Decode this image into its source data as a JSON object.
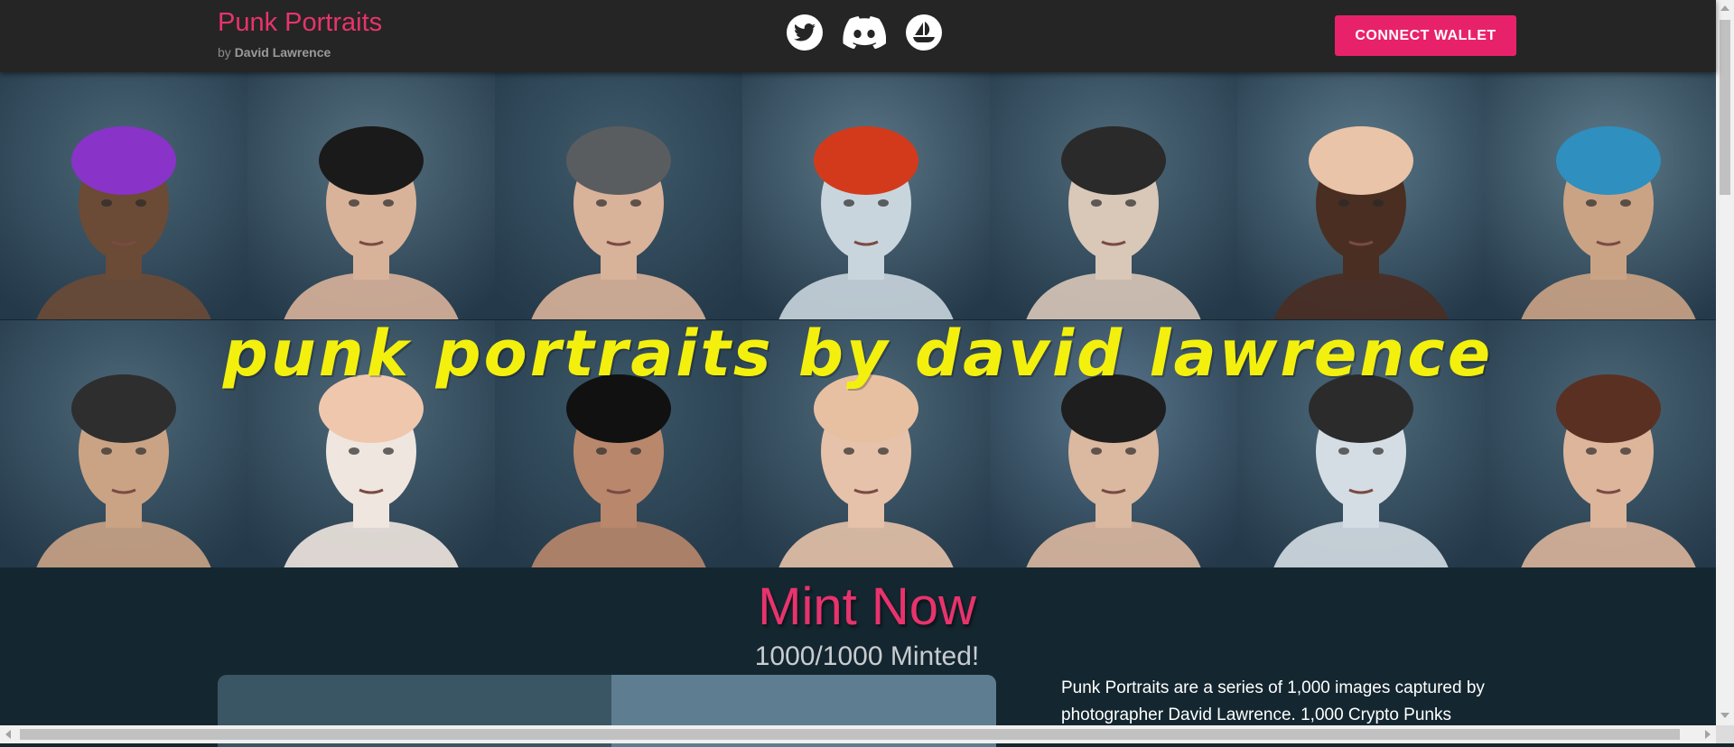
{
  "header": {
    "title": "Punk Portraits",
    "by_prefix": "by",
    "author": "David Lawrence",
    "connect_label": "CONNECT WALLET",
    "socials": [
      "twitter-icon",
      "discord-icon",
      "opensea-icon"
    ]
  },
  "hero": {
    "title": "punk portraits by david lawrence",
    "portraits": [
      {
        "name": "portrait-purple-wig-3d-glasses",
        "skin": "#6b4a36",
        "hair": "#8a33c8",
        "bg": "#4a6676"
      },
      {
        "name": "portrait-curly-hair-3d-glasses",
        "skin": "#d8b39a",
        "hair": "#1a1a1a",
        "bg": "#55707f"
      },
      {
        "name": "portrait-grey-hoodie-green-makeup",
        "skin": "#d9b29a",
        "hair": "#5a5d60",
        "bg": "#3f5b6b"
      },
      {
        "name": "portrait-red-beanie-face-mask",
        "skin": "#c9d5dd",
        "hair": "#d33a1c",
        "bg": "#5a7686"
      },
      {
        "name": "portrait-cap-eyepatch",
        "skin": "#d9c7b8",
        "hair": "#2a2a2a",
        "bg": "#4f6b7b"
      },
      {
        "name": "portrait-blonde-wig-blue-makeup",
        "skin": "#4a2e22",
        "hair": "#e9c4a8",
        "bg": "#5a7888"
      },
      {
        "name": "portrait-ape-bandana-glasses",
        "skin": "#caa385",
        "hair": "#2f8fbf",
        "bg": "#5d7a89"
      },
      {
        "name": "portrait-ape-flat-cap",
        "skin": "#caa385",
        "hair": "#2e2e2e",
        "bg": "#4c6878"
      },
      {
        "name": "portrait-blonde-curls-sunglasses",
        "skin": "#efe6df",
        "hair": "#efc7ad",
        "bg": "#4e6a7a"
      },
      {
        "name": "portrait-black-mask",
        "skin": "#b9876c",
        "hair": "#111111",
        "bg": "#3c5868"
      },
      {
        "name": "portrait-blonde-curls-goggles",
        "skin": "#e5c2a9",
        "hair": "#e7c0a2",
        "bg": "#4d6979"
      },
      {
        "name": "portrait-police-hat-clown-nose",
        "skin": "#dbb8a0",
        "hair": "#1e1e1e",
        "bg": "#58748a"
      },
      {
        "name": "portrait-cap-round-sunglasses-pipe",
        "skin": "#d4dde3",
        "hair": "#2b2b2b",
        "bg": "#4e6b7b"
      },
      {
        "name": "portrait-bob-wig-blue-makeup",
        "skin": "#dcb59b",
        "hair": "#5a3022",
        "bg": "#4a6676"
      }
    ]
  },
  "mint": {
    "title": "Mint Now",
    "count": "1000/1000 Minted!",
    "description": "Punk Portraits are a series of 1,000 images captured by photographer David Lawrence. 1,000 Crypto Punks"
  },
  "colors": {
    "accent": "#e8336d",
    "button": "#e8226a",
    "header_bg": "#252525",
    "page_bg": "#142730",
    "title_yellow": "#f4f00e"
  }
}
